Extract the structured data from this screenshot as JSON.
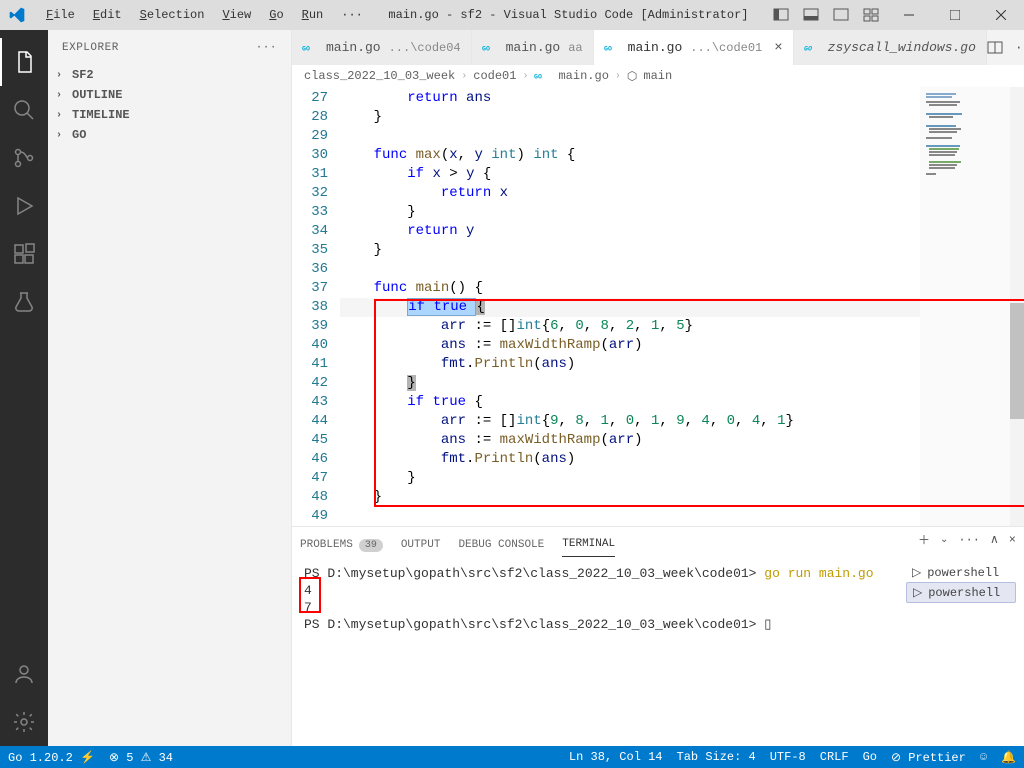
{
  "titlebar": {
    "title": "main.go - sf2 - Visual Studio Code [Administrator]"
  },
  "menus": {
    "file": "File",
    "edit": "Edit",
    "selection": "Selection",
    "view": "View",
    "go": "Go",
    "run": "Run",
    "more": "···"
  },
  "sidebar": {
    "title": "EXPLORER",
    "s1": "SF2",
    "s2": "OUTLINE",
    "s3": "TIMELINE",
    "s4": "GO"
  },
  "tabs": {
    "t1": {
      "name": "main.go",
      "sub": "...\\code04"
    },
    "t2": {
      "name": "main.go",
      "sub": "aa"
    },
    "t3": {
      "name": "main.go",
      "sub": "...\\code01"
    },
    "t4": {
      "name": "zsyscall_windows.go"
    }
  },
  "breadcrumbs": {
    "b1": "class_2022_10_03_week",
    "b2": "code01",
    "b3": "main.go",
    "b4": "main"
  },
  "lines": {
    "27": "27",
    "28": "28",
    "29": "29",
    "30": "30",
    "31": "31",
    "32": "32",
    "33": "33",
    "34": "34",
    "35": "35",
    "36": "36",
    "37": "37",
    "38": "38",
    "39": "39",
    "40": "40",
    "41": "41",
    "42": "42",
    "43": "43",
    "44": "44",
    "45": "45",
    "46": "46",
    "47": "47",
    "48": "48",
    "49": "49"
  },
  "panel": {
    "problems": "PROBLEMS",
    "output": "OUTPUT",
    "debug": "DEBUG CONSOLE",
    "terminal": "TERMINAL"
  },
  "terminal": {
    "prompt1_path": "PS D:\\mysetup\\gopath\\src\\sf2\\class_2022_10_03_week\\code01>",
    "cmd1": " go run main.go",
    "out1": "4",
    "out2": "7",
    "prompt2_path": "PS D:\\mysetup\\gopath\\src\\sf2\\class_2022_10_03_week\\code01>",
    "cursor": " ▯",
    "shell": "powershell"
  },
  "status": {
    "go": "Go 1.20.2",
    "lightning": "⚡",
    "err": "⊗ 5",
    "warn": "⚠ 34",
    "ln": "Ln 38, Col 14",
    "tab": "Tab Size: 4",
    "enc": "UTF-8",
    "eol": "CRLF",
    "lang": "Go",
    "prettier": "⊘ Prettier",
    "bell": "🔔"
  }
}
